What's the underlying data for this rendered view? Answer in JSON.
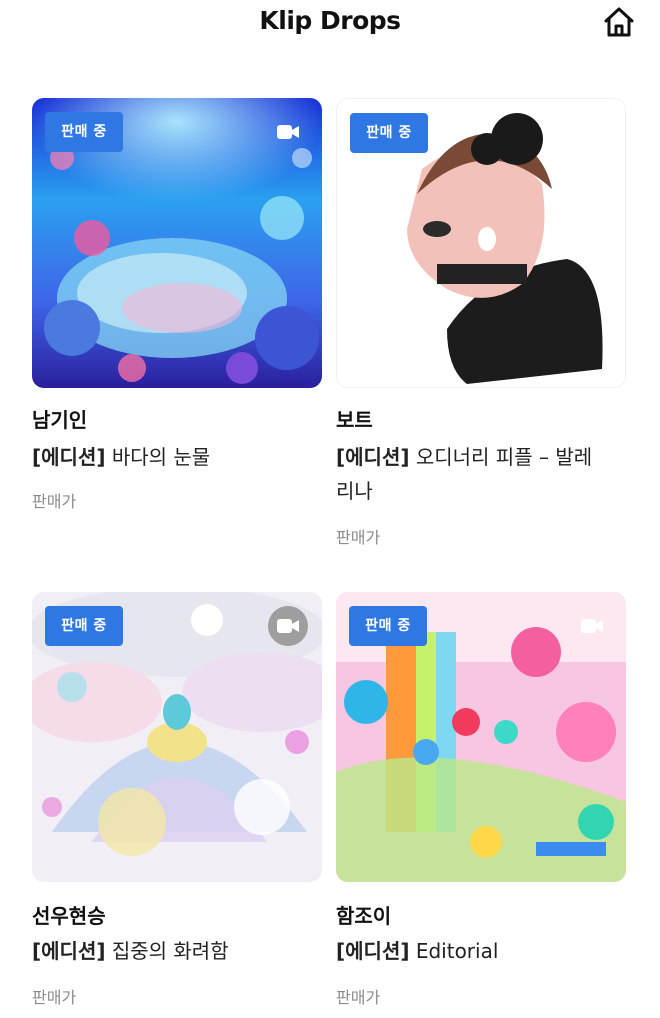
{
  "header": {
    "title": "Klip Drops",
    "home_icon": "home-icon"
  },
  "cards": [
    {
      "badge": "판매 중",
      "artist": "남기인",
      "edition_prefix": "[에디션]",
      "work": "바다의 눈물",
      "seller_label": "판매가",
      "has_video": true
    },
    {
      "badge": "판매 중",
      "artist": "보트",
      "edition_prefix": "[에디션]",
      "work_line1": "오디너리 피플 – 발레",
      "work_line2": "리나",
      "seller_label": "판매가",
      "has_video": false
    },
    {
      "badge": "판매 중",
      "artist": "선우현승",
      "edition_prefix": "[에디션]",
      "work": "집중의 화려함",
      "seller_label": "판매가",
      "has_video": true
    },
    {
      "badge": "판매 중",
      "artist": "함조이",
      "edition_prefix": "[에디션]",
      "work": "Editorial",
      "seller_label": "판매가",
      "has_video": true
    }
  ],
  "colors": {
    "badge": "#2f78e4",
    "seller_text": "#8c8c8c"
  }
}
